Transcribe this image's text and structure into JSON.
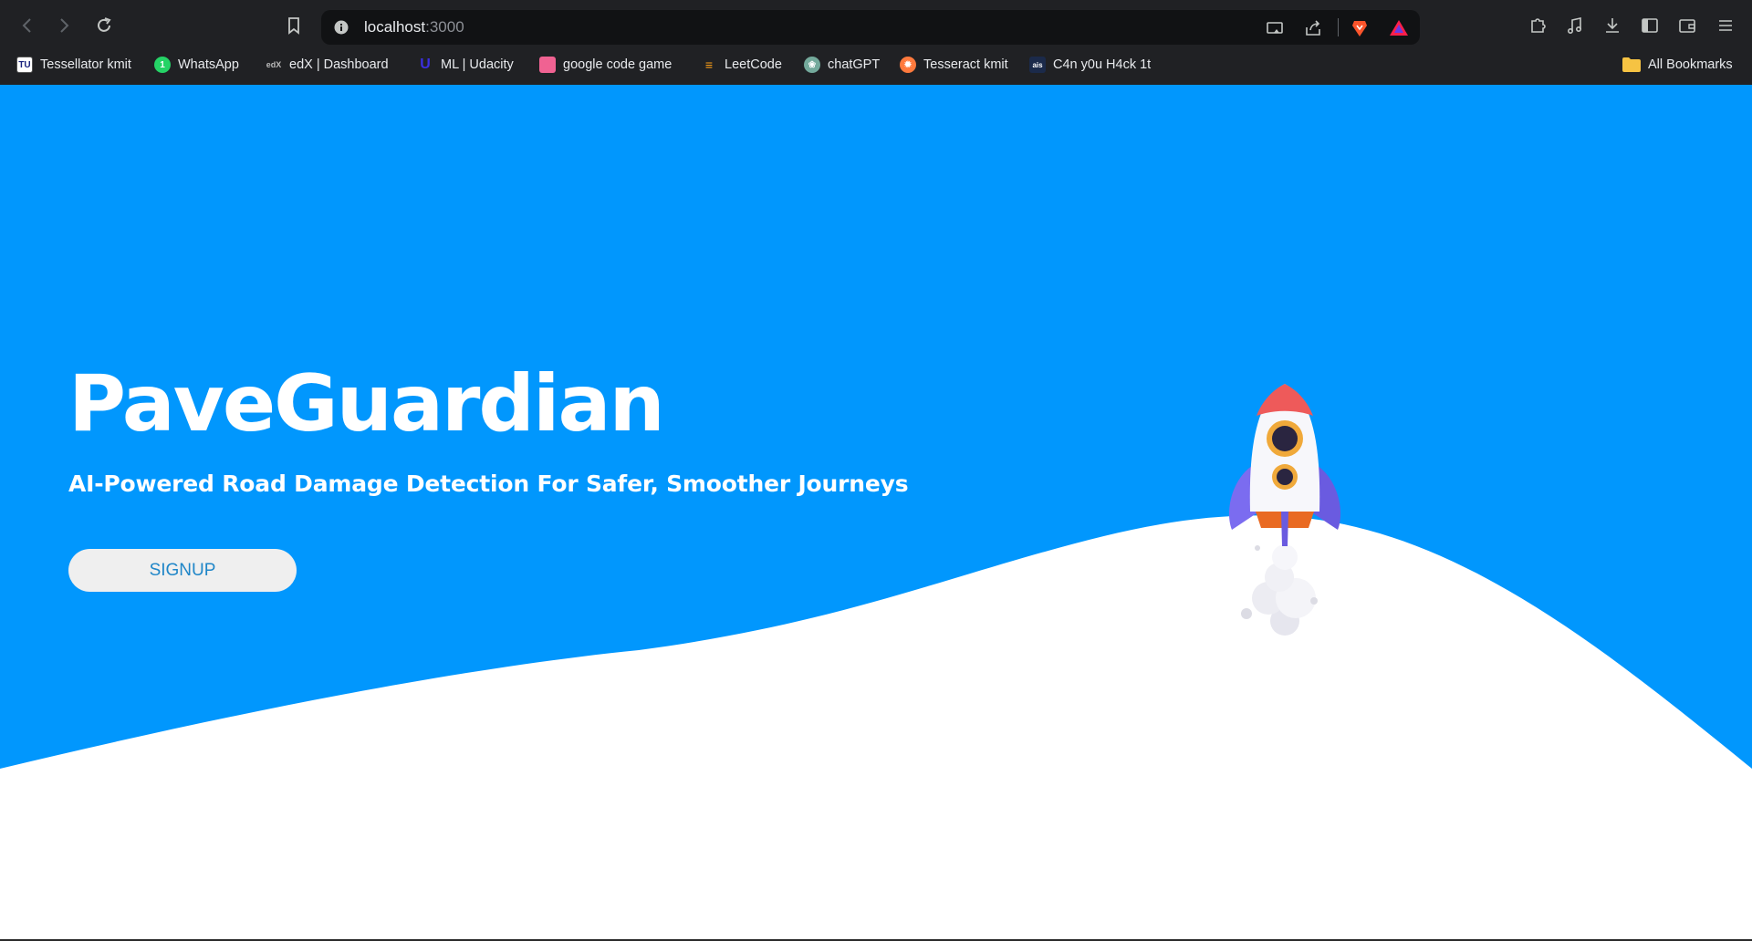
{
  "browser": {
    "url_host": "localhost",
    "url_port": ":3000",
    "bookmarks": [
      {
        "label": "Tessellator kmit",
        "icon": "tessellator-icon",
        "color": "#ffffff"
      },
      {
        "label": "WhatsApp",
        "icon": "whatsapp-icon",
        "color": "#25d366"
      },
      {
        "label": "edX  | Dashboard",
        "icon": "edx-icon",
        "color": "#2a2a2a"
      },
      {
        "label": "ML | Udacity",
        "icon": "udacity-icon",
        "color": "#3b2fe0"
      },
      {
        "label": "google code game",
        "icon": "bookmark-square-icon",
        "color": "#f06292"
      },
      {
        "label": "LeetCode",
        "icon": "leetcode-icon",
        "color": "#ffa116"
      },
      {
        "label": "chatGPT",
        "icon": "chatgpt-icon",
        "color": "#74aa9c"
      },
      {
        "label": "Tesseract kmit",
        "icon": "tesseract-icon",
        "color": "#ff7a3d"
      },
      {
        "label": "C4n y0u H4ck 1t",
        "icon": "ais-icon",
        "color": "#1b2a4a"
      }
    ],
    "all_bookmarks_label": "All Bookmarks"
  },
  "hero": {
    "title": "PaveGuardian",
    "subtitle": "AI-Powered Road Damage Detection For Safer, Smoother Journeys",
    "signup_label": "SIGNUP"
  },
  "colors": {
    "background": "#0197fd",
    "wave": "#ffffff",
    "button_bg": "#efefef",
    "button_text": "#1f86c8"
  }
}
